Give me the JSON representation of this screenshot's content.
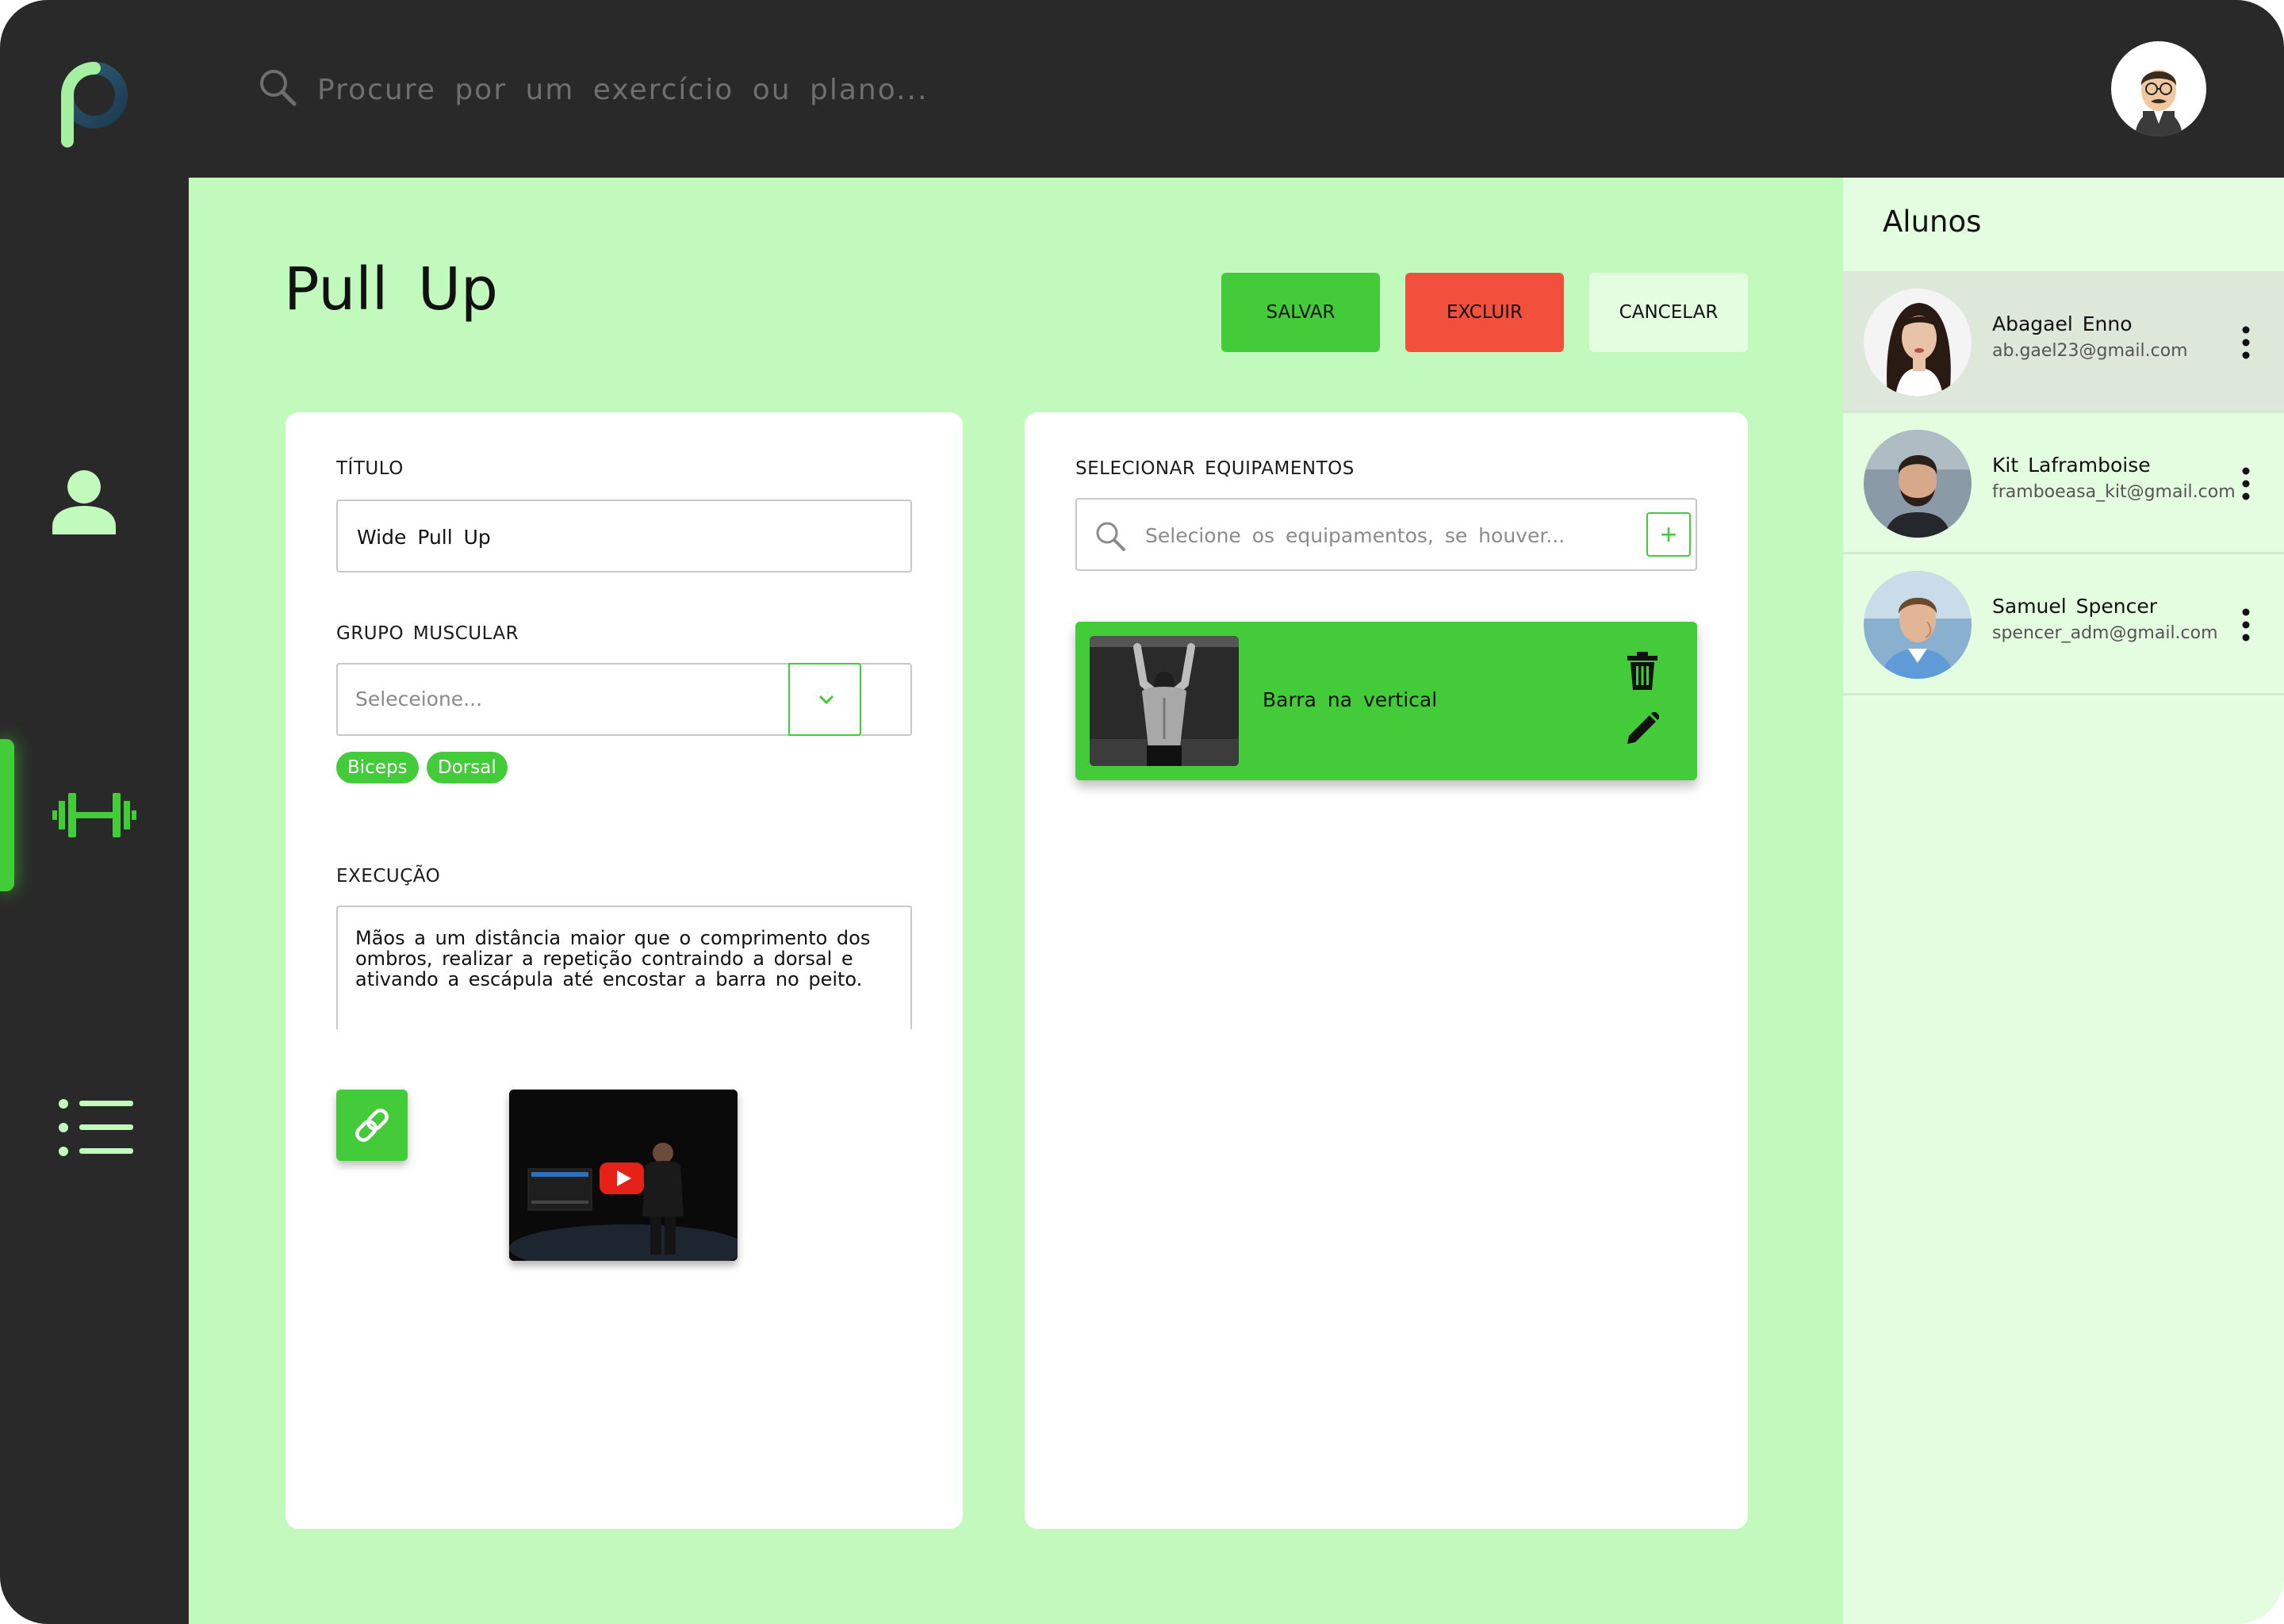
{
  "colors": {
    "accent": "#43cb3a",
    "danger": "#f2503c",
    "sidebar": "#292929",
    "main_bg": "#c2f9bc",
    "panel_bg": "#e4fcdf"
  },
  "sidebar": {
    "logo": "p-logo",
    "items": [
      {
        "icon": "user-icon",
        "active": false
      },
      {
        "icon": "dumbbell-icon",
        "active": true
      },
      {
        "icon": "list-icon",
        "active": false
      }
    ]
  },
  "topbar": {
    "search_placeholder": "Procure por um exercício ou plano...",
    "avatar": "avatar-cartoon"
  },
  "page": {
    "title": "Pull Up",
    "actions": {
      "save": "SALVAR",
      "delete": "EXCLUIR",
      "cancel": "CANCELAR"
    }
  },
  "form": {
    "titulo_label": "TÍTULO",
    "titulo_value": "Wide Pull Up",
    "grupo_label": "GRUPO MUSCULAR",
    "grupo_placeholder": "Seleceione...",
    "tags": [
      "Biceps",
      "Dorsal"
    ],
    "execucao_label": "EXECUÇÃO",
    "execucao_value": "Mãos a um distância maior que o comprimento dos ombros, realizar a repetição contraindo a dorsal e ativando a escápula até encostar a barra no peito."
  },
  "equipment": {
    "label": "SELECIONAR EQUIPAMENTOS",
    "search_placeholder": "Selecione os equipamentos, se houver...",
    "add_label": "+",
    "items": [
      {
        "name": "Barra na vertical"
      }
    ]
  },
  "students": {
    "title": "Alunos",
    "items": [
      {
        "name": "Abagael Enno",
        "email": "ab.gael23@gmail.com",
        "selected": true
      },
      {
        "name": "Kit Laframboise",
        "email": "framboeasa_kit@gmail.com",
        "selected": false
      },
      {
        "name": "Samuel Spencer",
        "email": "spencer_adm@gmail.com",
        "selected": false
      }
    ]
  }
}
